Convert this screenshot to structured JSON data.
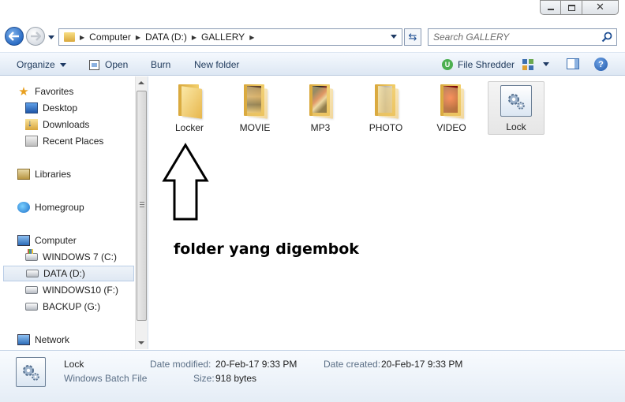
{
  "window": {
    "controls": {
      "minimize": "minimize",
      "maximize": "maximize",
      "close": "close"
    }
  },
  "address": {
    "breadcrumbs": [
      "Computer",
      "DATA (D:)",
      "GALLERY"
    ],
    "search_placeholder": "Search GALLERY"
  },
  "toolbar": {
    "organize": "Organize",
    "open": "Open",
    "burn": "Burn",
    "new_folder": "New folder",
    "file_shredder": "File Shredder",
    "help": "?"
  },
  "navigation": {
    "favorites": "Favorites",
    "desktop": "Desktop",
    "downloads": "Downloads",
    "recent_places": "Recent Places",
    "libraries": "Libraries",
    "homegroup": "Homegroup",
    "computer": "Computer",
    "drives": [
      "WINDOWS 7 (C:)",
      "DATA (D:)",
      "WINDOWS10 (F:)",
      "BACKUP (G:)"
    ],
    "network": "Network"
  },
  "files": [
    {
      "name": "Locker",
      "type": "folder",
      "media": "none"
    },
    {
      "name": "MOVIE",
      "type": "folder",
      "media": "movie"
    },
    {
      "name": "MP3",
      "type": "folder",
      "media": "mp3"
    },
    {
      "name": "PHOTO",
      "type": "folder",
      "media": "photo"
    },
    {
      "name": "VIDEO",
      "type": "folder",
      "media": "video"
    },
    {
      "name": "Lock",
      "type": "batch-file",
      "selected": true
    }
  ],
  "annotation": {
    "text": "folder yang digembok"
  },
  "details": {
    "name": "Lock",
    "type": "Windows Batch File",
    "date_modified_label": "Date modified:",
    "date_modified": "20-Feb-17 9:33 PM",
    "date_created_label": "Date created:",
    "date_created": "20-Feb-17 9:33 PM",
    "size_label": "Size:",
    "size": "918 bytes"
  },
  "colors": {
    "toolbar_text": "#1e395b",
    "details_key": "#5b6f86",
    "nav_selected": "#dfe8f3"
  }
}
